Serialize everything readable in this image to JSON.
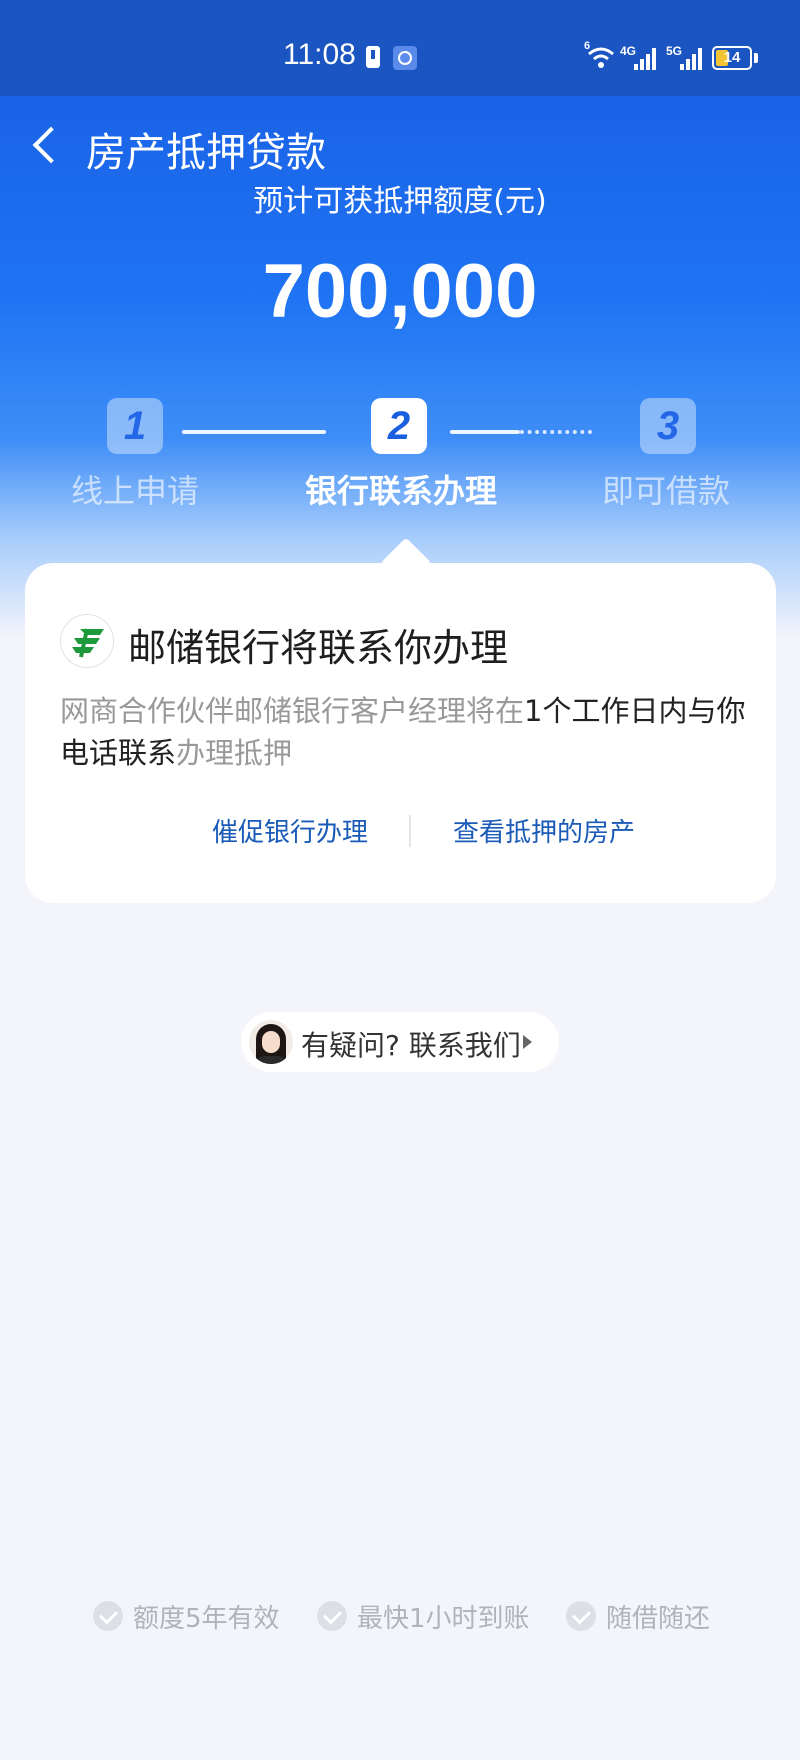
{
  "status_bar": {
    "time": "11:08",
    "battery": "14",
    "network_left": "6",
    "network_4g": "4G",
    "network_5g": "5G"
  },
  "header": {
    "title": "房产抵押贷款"
  },
  "quota": {
    "label": "预计可获抵押额度(元)",
    "value": "700,000"
  },
  "steps": [
    {
      "number": "1",
      "label": "线上申请",
      "state": "done"
    },
    {
      "number": "2",
      "label": "银行联系办理",
      "state": "current"
    },
    {
      "number": "3",
      "label": "即可借款",
      "state": "pending"
    }
  ],
  "card": {
    "title": "邮储银行将联系你办理",
    "desc_part1": "网商合作伙伴邮储银行客户经理将在",
    "desc_highlight": "1个工作日内与你电话联系",
    "desc_part2": "办理抵押",
    "button_urge": "催促银行办理",
    "button_view": "查看抵押的房产",
    "logo_icon": "postal-bank-logo"
  },
  "contact": {
    "label": "有疑问? 联系我们"
  },
  "features": [
    {
      "label": "额度5年有效"
    },
    {
      "label": "最快1小时到账"
    },
    {
      "label": "随借随还"
    }
  ],
  "colors": {
    "primary_blue": "#1f74f3",
    "link_blue": "#1a5bb8",
    "logo_green": "#1e9a3c",
    "background": "#f4f5fb"
  }
}
